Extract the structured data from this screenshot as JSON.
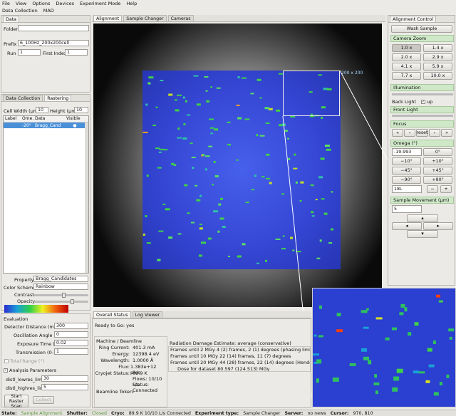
{
  "menu": [
    "File",
    "View",
    "Options",
    "Devices",
    "Experiment Mode",
    "Help"
  ],
  "submenu": [
    "Data Collection",
    "MAD"
  ],
  "data_panel": {
    "tab": "Data",
    "folder_label": "Folder",
    "folder_value": "",
    "prefix_label": "Prefix",
    "prefix_value": "6_100Hz_200x200cell",
    "run_label": "Run",
    "run_value": "1",
    "first_index_label": "First Index",
    "first_index_value": "1"
  },
  "raster_panel": {
    "tabs": [
      "Data Collection",
      "Rastering"
    ],
    "cell_width_label": "Cell Width (µm)",
    "cell_width_value": "10",
    "height_label": "Height (µm)",
    "height_value": "10",
    "table_headers": [
      "Label",
      "Ome.",
      "Data",
      "Visible"
    ],
    "row_ome": "-20°",
    "row_data": "Bragg_Cand",
    "property_label": "Property",
    "property_value": "Bragg_Candidates",
    "color_scheme_label": "Color Scheme",
    "color_scheme_value": "Rainbow",
    "contrast_label": "Contrast",
    "opacity_label": "Opacity"
  },
  "evaluation": {
    "title": "Evaluation",
    "detector_distance_label": "Detector Distance (mm)",
    "detector_distance_value": "300",
    "oscillation_label": "Oscillation Angle (°)",
    "oscillation_value": "0",
    "exposure_label": "Exposure Time (s)",
    "exposure_value": "0.02",
    "transmission_label": "Transmission (0-1)",
    "transmission_value": "1",
    "total_range_label": "Total Range (°)",
    "analysis_label": "Analysis Parameters",
    "distl_lowres_label": "distl_lowres_limit",
    "distl_lowres_value": "30",
    "distl_highres_label": "distl_highres_limit",
    "distl_highres_value": "5",
    "start_label": "Start Raster Scan",
    "collect_label": "Collect"
  },
  "center_tabs": [
    "Alignment",
    "Sample Changer",
    "Cameras"
  ],
  "raster_label": "200 x 200",
  "status_tabs": [
    "Overall Status",
    "Log Viewer"
  ],
  "status": {
    "ready": "Ready to Go: yes",
    "machine_title": "Machine / Beamline",
    "ring_current_label": "Ring Current:",
    "ring_current": "401.3 mA",
    "energy_label": "Energy:",
    "energy": "12398.4 eV",
    "wavelength_label": "Wavelength:",
    "wavelength": "1.0000 Å",
    "flux_label": "Flux:",
    "flux": "1.383e+12 ph/s",
    "cryojet_label": "Cryojet Status:",
    "cryojet": "89.9 K",
    "flows": "Flows: 10/10 L/s",
    "status_connected": "Status: Connected",
    "beamline_token_label": "Beamline Token:",
    "radiation_title": "Radiation Damage Estimate: average (conservative)",
    "rad_lines": [
      "Frames until 2 MGy 4 (2) frames, 2 (1) degrees (phasing limit)",
      "Frames until 10 MGy 22 (14) frames, 11 (7) degrees",
      "Frames until 20 MGy 44 (28) frames, 22 (14) degrees (Henderson limit"
    ],
    "dose_line": "Dose for dataset 80.597 (124.513) MGy"
  },
  "alignment_control": {
    "tab": "Alignment Control",
    "wash_label": "Wash Sample",
    "camera_zoom_title": "Camera Zoom",
    "zoom_buttons": [
      "1.0 x",
      "1.4 x",
      "2.0 x",
      "2.9 x",
      "4.1 x",
      "5.9 x",
      "7.7 x",
      "10.0 x"
    ],
    "illumination_title": "Illumination",
    "back_light_label": "Back Light",
    "back_light_check": "up",
    "front_light_label": "Front Light",
    "focus_title": "Focus",
    "focus_buttons": [
      "«",
      "‹",
      "reset",
      "›",
      "»"
    ],
    "omega_title": "Omega (°)",
    "omega_value": "-19.993",
    "omega_buttons": [
      "0°",
      "−10°",
      "+10°",
      "−45°",
      "+45°",
      "−90°",
      "+90°"
    ],
    "omega_step": "18L",
    "sample_movement_title": "Sample Movement (µm)",
    "sample_step": "5"
  },
  "statusbar": {
    "state_label": "State:",
    "state_value": "Sample Alignment",
    "shutter_label": "Shutter:",
    "shutter_value": "Closed",
    "cryo_label": "Cryo:",
    "cryo_value": "89.9 K 10/10 L/s Connected",
    "exp_label": "Experiment type:",
    "exp_value": "Sample Changer",
    "server_label": "Server:",
    "server_value": "no news",
    "cursor_label": "Cursor:",
    "cursor_value": "970, 810"
  }
}
